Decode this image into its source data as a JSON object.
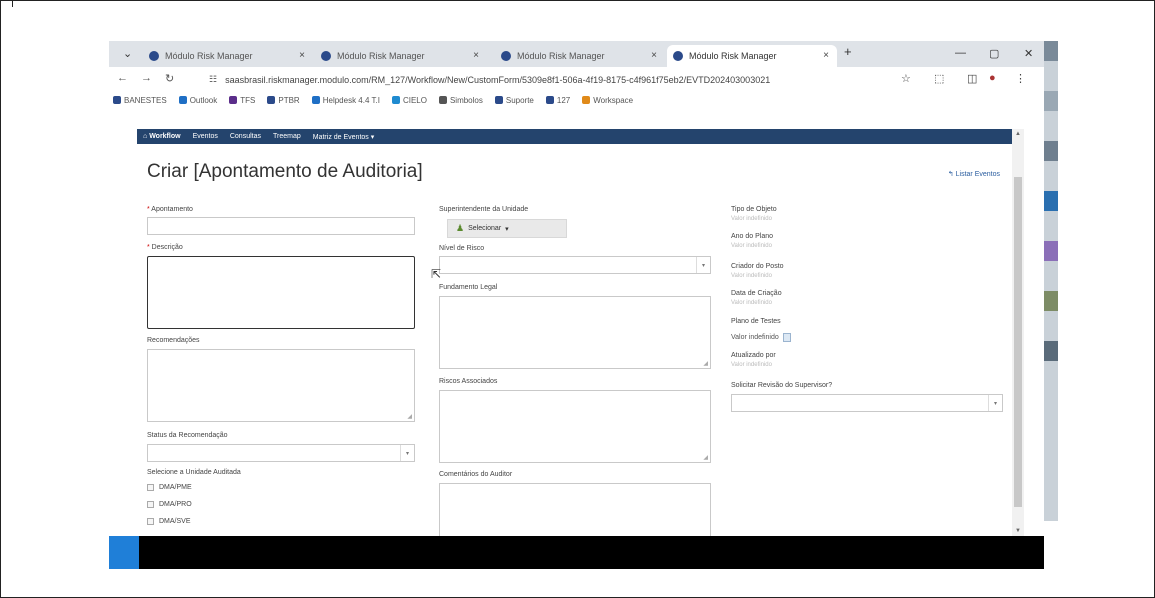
{
  "browser": {
    "tabs": [
      {
        "label": "Módulo Risk Manager"
      },
      {
        "label": "Módulo Risk Manager"
      },
      {
        "label": "Módulo Risk Manager"
      },
      {
        "label": "Módulo Risk Manager"
      }
    ],
    "new_tab": "+",
    "url": "saasbrasil.riskmanager.modulo.com/RM_127/Workflow/New/CustomForm/5309e8f1-506a-4f19-8175-c4f961f75eb2/EVTD202403003021",
    "bookmarks": [
      {
        "label": "BANESTES",
        "color": "#2b4a8a"
      },
      {
        "label": "Outlook",
        "color": "#1f6fc5"
      },
      {
        "label": "TFS",
        "color": "#5b2d8a"
      },
      {
        "label": "PTBR",
        "color": "#2b4a8a"
      },
      {
        "label": "Helpdesk 4.4 T.I",
        "color": "#1f6fc5"
      },
      {
        "label": "CIELO",
        "color": "#1f8bd0"
      },
      {
        "label": "Simbolos",
        "color": "#555555"
      },
      {
        "label": "Suporte",
        "color": "#2b4a8a"
      },
      {
        "label": "127",
        "color": "#2b4a8a"
      },
      {
        "label": "Workspace",
        "color": "#e08a1a"
      }
    ]
  },
  "app": {
    "nav": [
      "Workflow",
      "Eventos",
      "Consultas",
      "Treemap",
      "Matriz de Eventos"
    ],
    "title": "Criar [Apontamento de Auditoria]",
    "list_link": "Listar Eventos",
    "col1": {
      "apontamento_label": "Apontamento",
      "descricao_label": "Descrição",
      "recomendacoes_label": "Recomendações",
      "status_label": "Status da Recomendação",
      "unidade_label": "Selecione a Unidade Auditada",
      "unidades": [
        "DMA/PME",
        "DMA/PRO",
        "DMA/SVE"
      ]
    },
    "col2": {
      "superintendente_label": "Superintendente da Unidade",
      "selecionar": "Selecionar",
      "nivel_label": "Nível de Risco",
      "fundamento_label": "Fundamento Legal",
      "riscos_label": "Riscos Associados",
      "comentarios_label": "Comentários do Auditor"
    },
    "col3": {
      "tipo_label": "Tipo de Objeto",
      "ano_label": "Ano do Plano",
      "criador_label": "Criador do Posto",
      "data_label": "Data de Criação",
      "plano_label": "Plano de Testes",
      "plano_value": "Valor indefinido",
      "atualizado_label": "Atualizado por",
      "revisao_label": "Solicitar Revisão do Supervisor?",
      "placeholder_value": "Valor indefinido"
    }
  }
}
